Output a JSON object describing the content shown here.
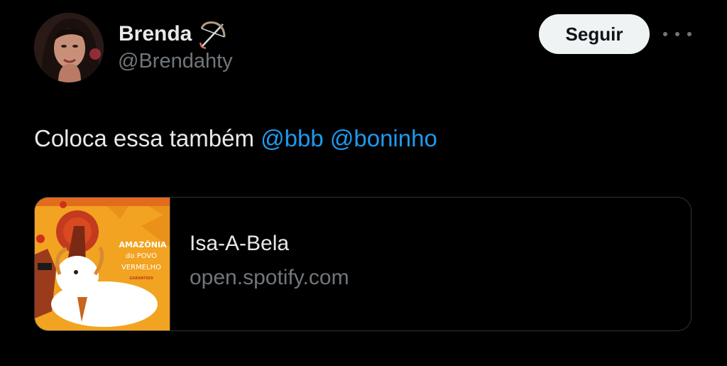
{
  "user": {
    "display_name": "Brenda",
    "name_emoji": "sagittarius-bow-and-arrow",
    "handle": "@Brendahty",
    "avatar": "profile-photo"
  },
  "actions": {
    "follow_label": "Seguir",
    "more_icon": "ellipsis-horizontal-icon"
  },
  "tweet": {
    "text": "Coloca essa também ",
    "mentions": [
      "@bbb",
      "@boninho"
    ]
  },
  "link_card": {
    "title": "Isa-A-Bela",
    "domain": "open.spotify.com",
    "thumbnail_text": {
      "line1": "AMAZÔNIA",
      "line2": "do POVO",
      "line3": "VERMELHO",
      "footer": "GARANTIDO"
    }
  },
  "colors": {
    "background": "#000000",
    "text": "#e7e9ea",
    "secondary": "#71767b",
    "link": "#1d9bf0",
    "button_bg": "#eff3f4",
    "thumb_orange": "#f2a321"
  }
}
